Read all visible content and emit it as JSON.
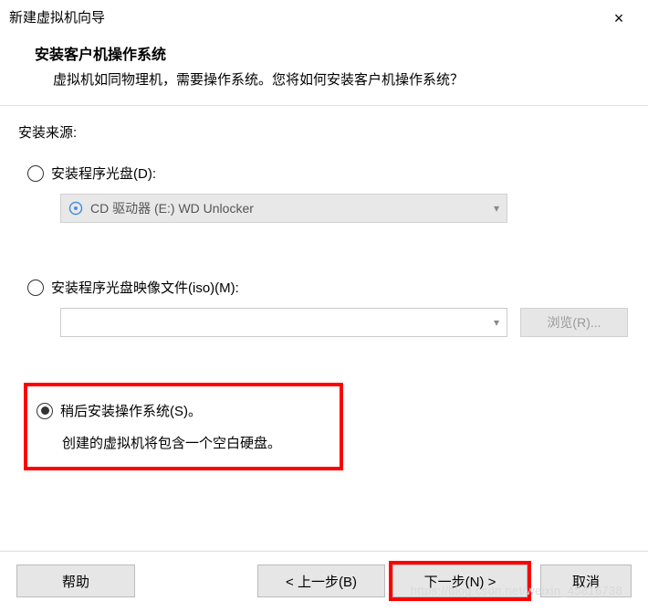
{
  "titlebar": {
    "title": "新建虚拟机向导",
    "close_label": "×"
  },
  "header": {
    "title": "安装客户机操作系统",
    "description": "虚拟机如同物理机，需要操作系统。您将如何安装客户机操作系统？"
  },
  "body": {
    "source_label": "安装来源:",
    "option_disc": {
      "label": "安装程序光盘(D):",
      "dropdown_text": "CD 驱动器 (E:) WD Unlocker"
    },
    "option_iso": {
      "label": "安装程序光盘映像文件(iso)(M):",
      "browse_label": "浏览(R)..."
    },
    "option_later": {
      "label": "稍后安装操作系统(S)。",
      "description": "创建的虚拟机将包含一个空白硬盘。"
    }
  },
  "buttons": {
    "help": "帮助",
    "back": "< 上一步(B)",
    "next": "下一步(N) >",
    "cancel": "取消"
  },
  "watermark": "https://blog.csdn.net/weixin_45816738"
}
